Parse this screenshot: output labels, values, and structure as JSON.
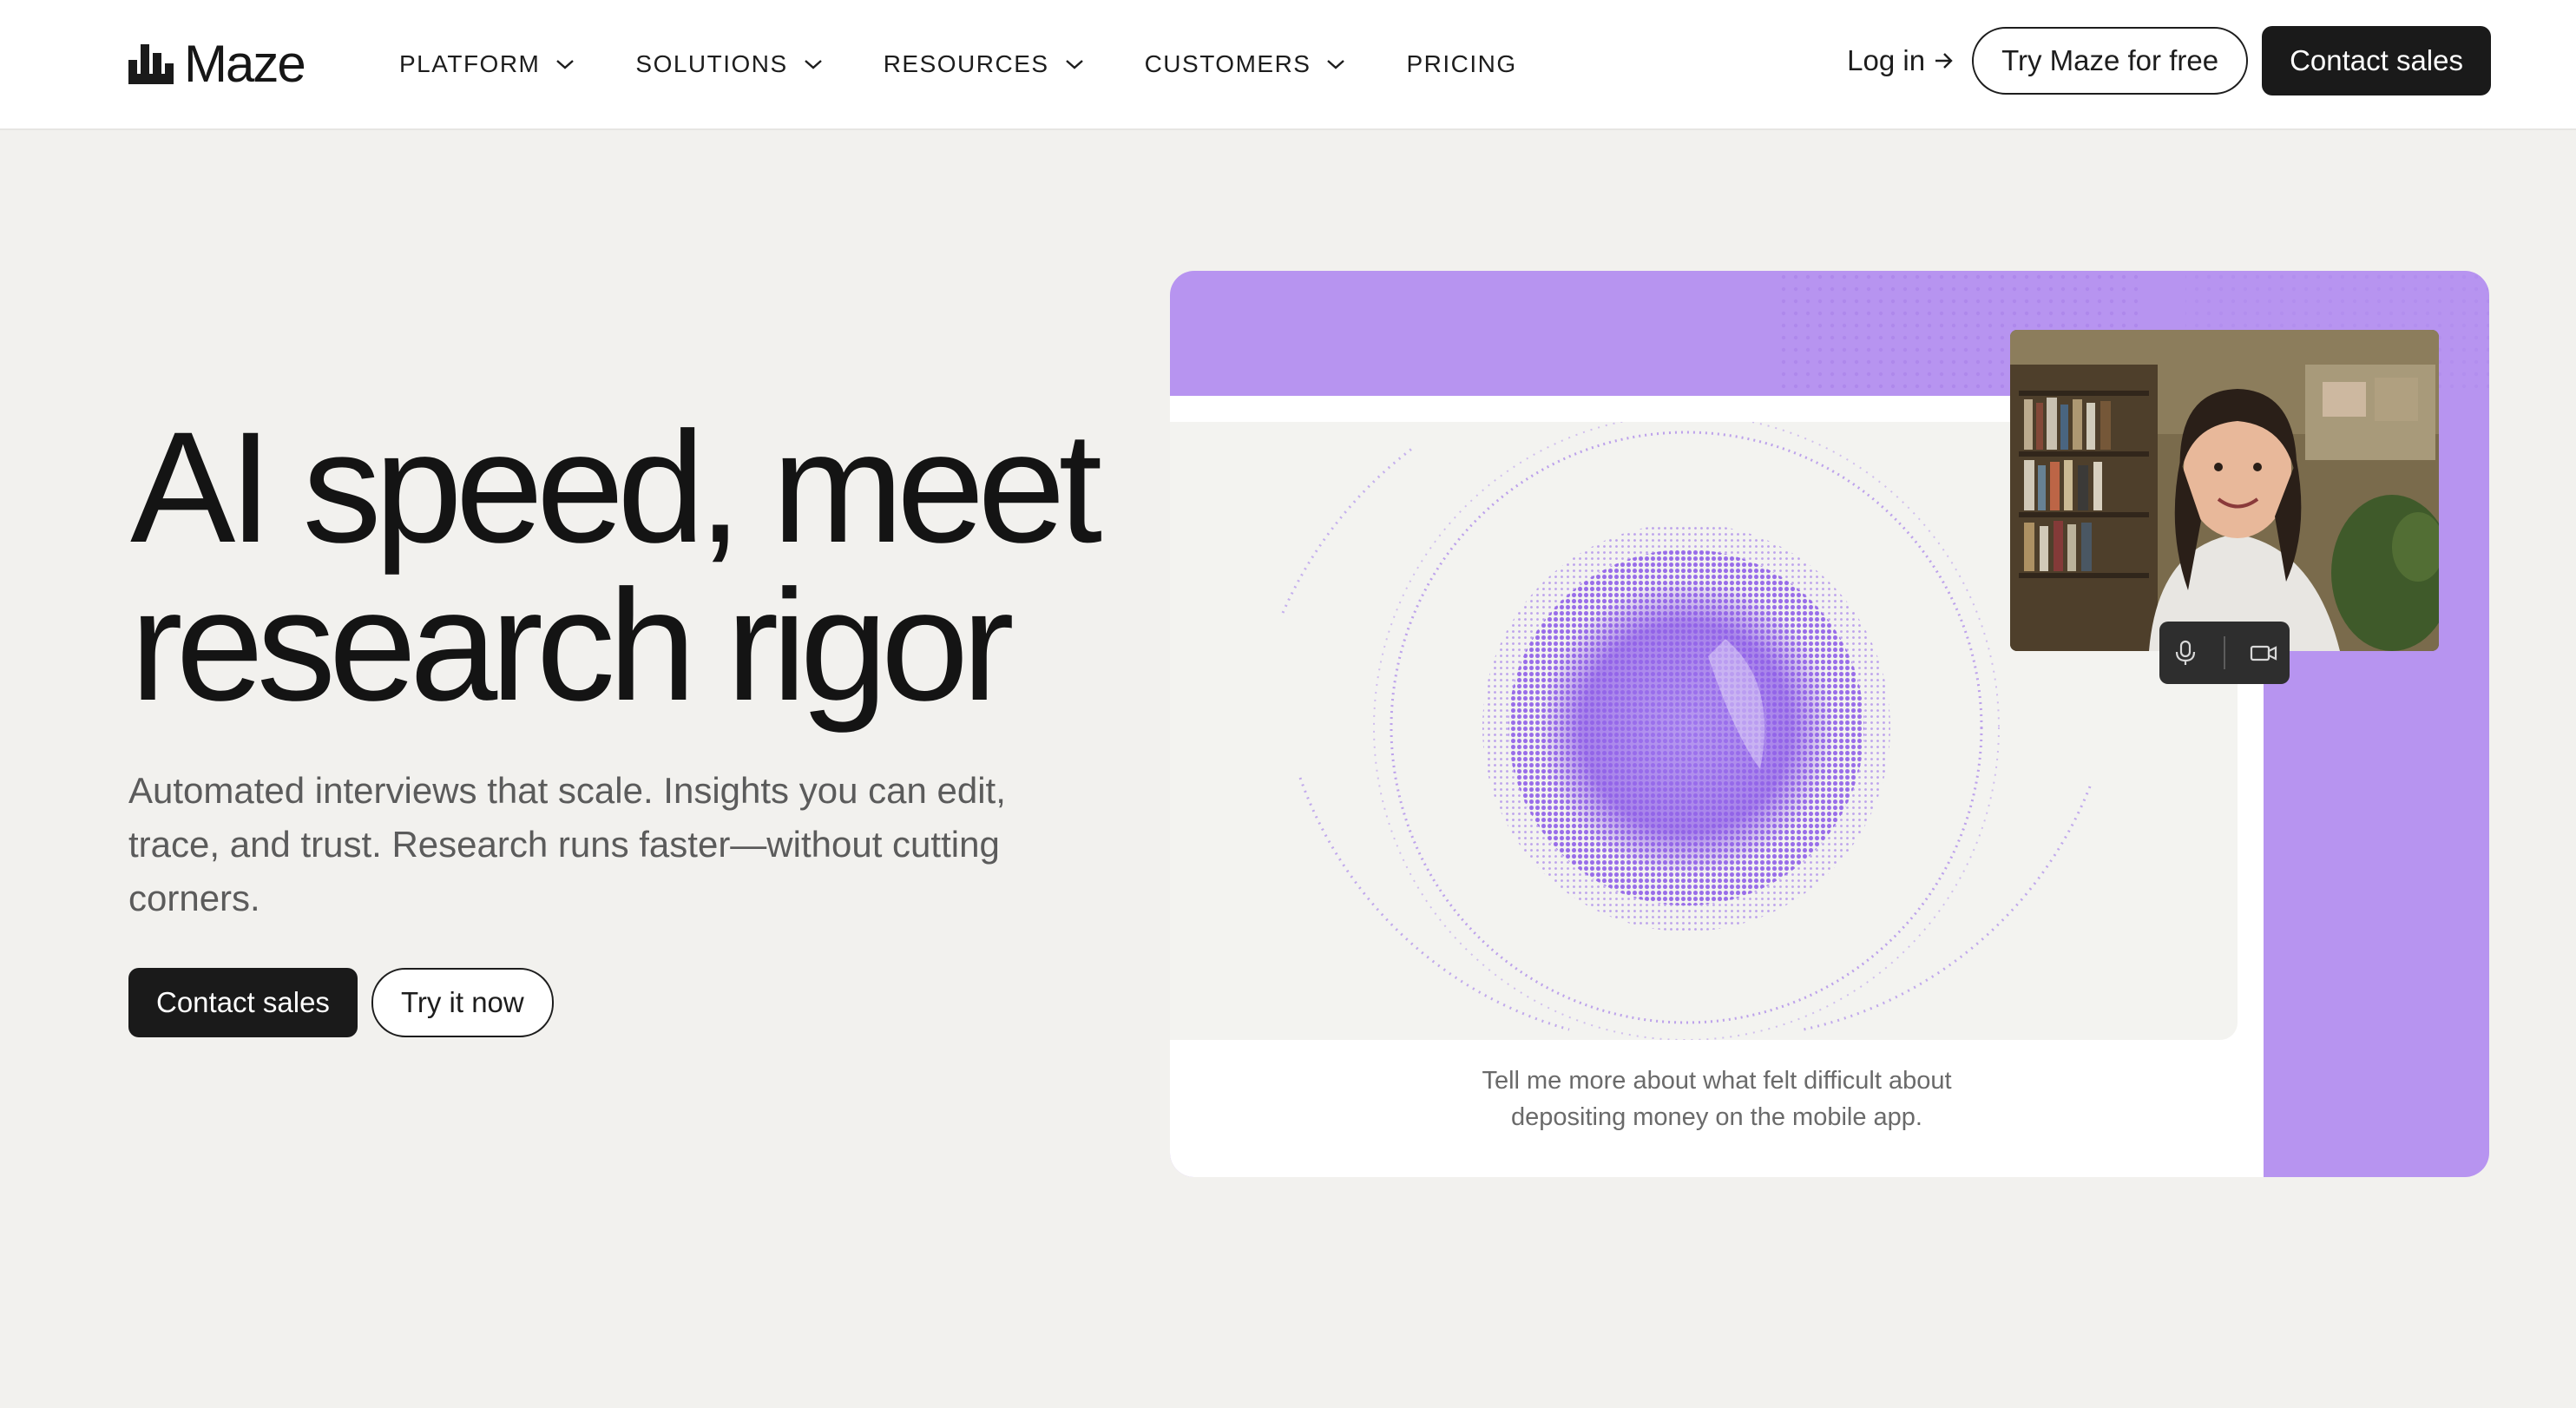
{
  "nav": {
    "logo_text": "Maze",
    "menu": [
      {
        "label": "PLATFORM",
        "has_dropdown": true
      },
      {
        "label": "SOLUTIONS",
        "has_dropdown": true
      },
      {
        "label": "RESOURCES",
        "has_dropdown": true
      },
      {
        "label": "CUSTOMERS",
        "has_dropdown": true
      },
      {
        "label": "PRICING",
        "has_dropdown": false
      }
    ],
    "login_label": "Log in",
    "try_label": "Try Maze for free",
    "contact_label": "Contact sales"
  },
  "hero": {
    "title_line1": "AI speed, meet",
    "title_line2": "research rigor",
    "subtitle": "Automated interviews that scale. Insights you can edit, trace, and trust. Research runs faster—without cutting corners.",
    "cta_primary": "Contact sales",
    "cta_secondary": "Try it now"
  },
  "media": {
    "caption_line1": "Tell me more about what felt difficult about",
    "caption_line2": "depositing money on the mobile app.",
    "mic_icon": "microphone-icon",
    "camera_icon": "video-camera-icon"
  },
  "colors": {
    "accent_purple": "#b794f0",
    "orb_purple": "#8f5fe8",
    "button_dark": "#1a1a1a",
    "background": "#f2f1ee"
  }
}
